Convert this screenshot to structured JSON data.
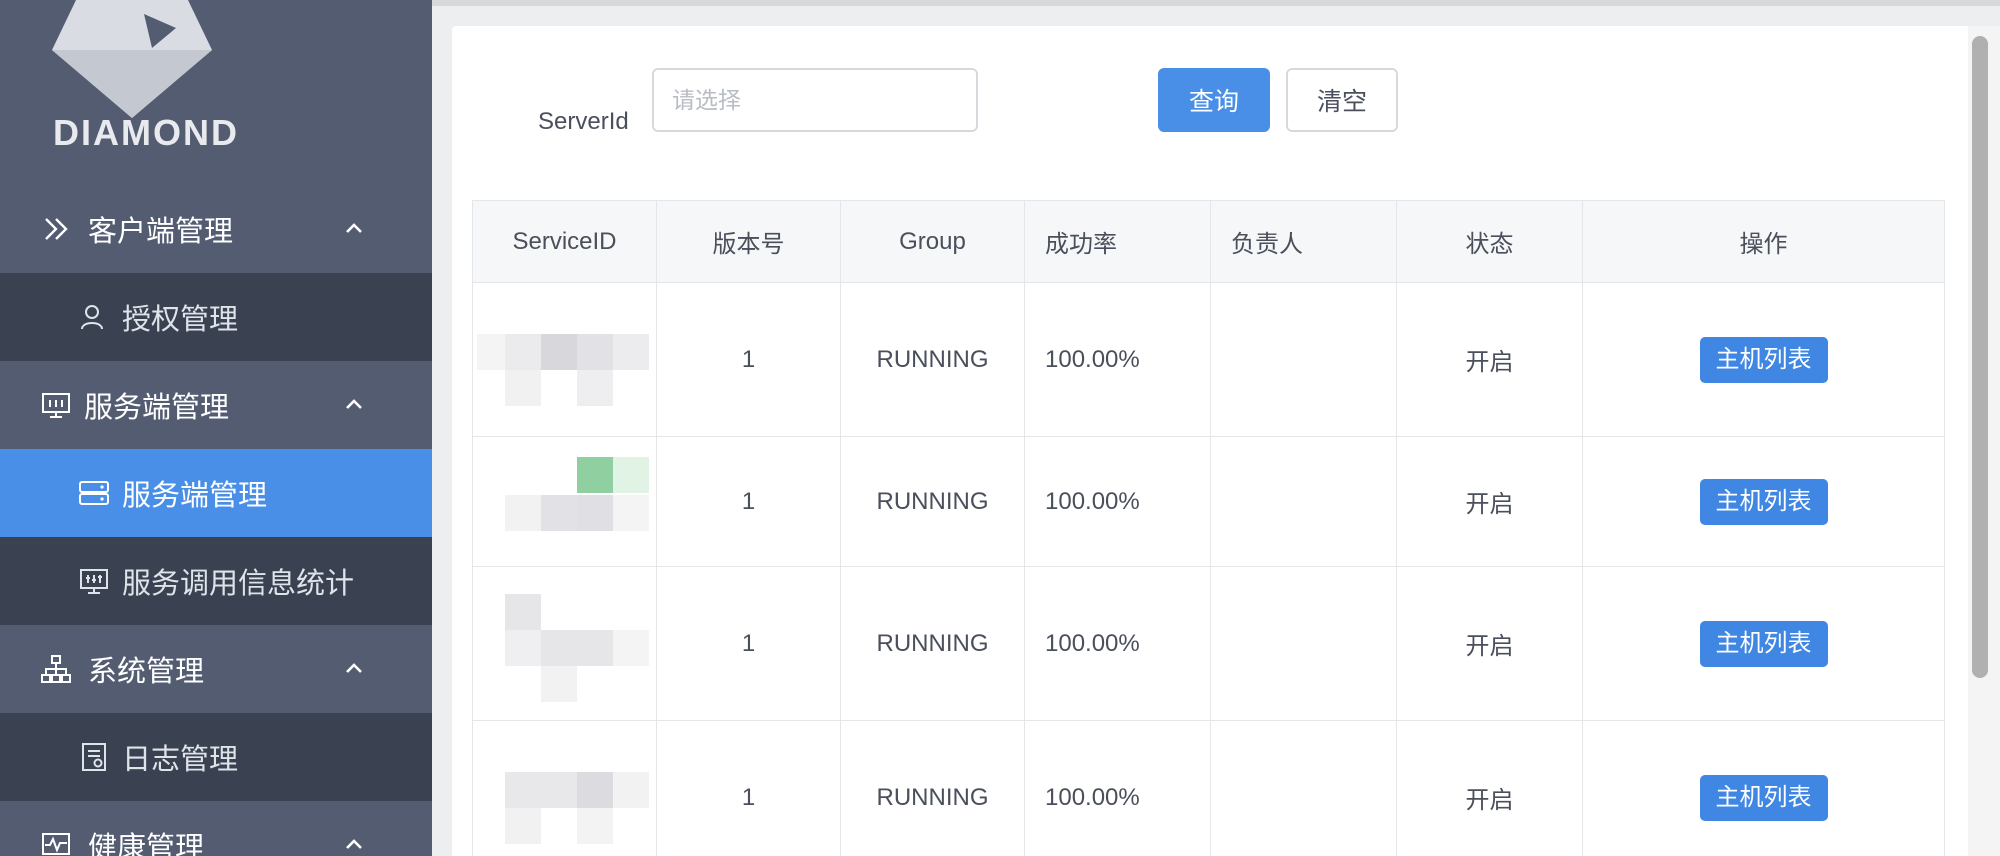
{
  "sidebar": {
    "logo_text": "DIAMOND",
    "groups": [
      {
        "label": "客户端管理",
        "icon": "client-icon",
        "items": [
          {
            "label": "授权管理",
            "icon": "user-auth-icon",
            "active": false
          }
        ]
      },
      {
        "label": "服务端管理",
        "icon": "monitor-icon",
        "items": [
          {
            "label": "服务端管理",
            "icon": "server-icon",
            "active": true
          },
          {
            "label": "服务调用信息统计",
            "icon": "stats-icon",
            "active": false
          }
        ]
      },
      {
        "label": "系统管理",
        "icon": "sitemap-icon",
        "items": [
          {
            "label": "日志管理",
            "icon": "log-icon",
            "active": false
          }
        ]
      },
      {
        "label": "健康管理",
        "icon": "health-icon",
        "items": []
      }
    ]
  },
  "filter": {
    "label": "ServerId",
    "placeholder": "请选择",
    "query_label": "查询",
    "clear_label": "清空"
  },
  "table": {
    "headers": [
      "ServiceID",
      "版本号",
      "Group",
      "成功率",
      "负责人",
      "状态",
      "操作"
    ],
    "rows": [
      {
        "service_id": "",
        "version": "1",
        "group": "RUNNING",
        "success_rate": "100.00%",
        "owner": "",
        "status": "开启",
        "action": "主机列表"
      },
      {
        "service_id": "",
        "version": "1",
        "group": "RUNNING",
        "success_rate": "100.00%",
        "owner": "",
        "status": "开启",
        "action": "主机列表"
      },
      {
        "service_id": "",
        "version": "1",
        "group": "RUNNING",
        "success_rate": "100.00%",
        "owner": "",
        "status": "开启",
        "action": "主机列表"
      },
      {
        "service_id": "",
        "version": "1",
        "group": "RUNNING",
        "success_rate": "100.00%",
        "owner": "",
        "status": "开启",
        "action": "主机列表"
      }
    ]
  },
  "colors": {
    "sidebar_bg": "#545c72",
    "submenu_bg": "#3a4150",
    "active": "#4a8fe7",
    "primary_button": "#3f87e3"
  }
}
